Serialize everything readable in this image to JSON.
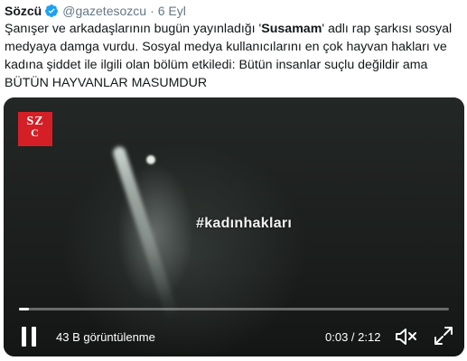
{
  "tweet": {
    "display_name": "Sözcü",
    "handle": "@gazetesozcu",
    "separator": "·",
    "date": "6 Eyl",
    "verified_color": "#1da1f2",
    "text": {
      "line1_prefix": "Şanışer ve arkadaşlarının bugün yayınladığı '",
      "line1_bold": "Susamam",
      "line1_suffix": "' adlı rap şarkısı sosyal",
      "line2": "medyaya damga vurdu. Sosyal medya kullanıcılarını en çok hayvan hakları ve",
      "line3": "kadına şiddet ile ilgili olan bölüm etkiledi: Bütün insanlar suçlu değildir ama",
      "line4": "BÜTÜN HAYVANLAR MASUMDUR"
    }
  },
  "video": {
    "logo_line1": "SZ",
    "logo_line2": "C",
    "logo_color": "#d41f26",
    "overlay_text": "#kadınhakları",
    "views": "43 B görüntülenme",
    "time": "0:03 / 2:12",
    "progress": 0.023,
    "icons": {
      "play_state": "pause-icon",
      "volume": "mute-icon",
      "fullscreen": "fullscreen-icon"
    }
  }
}
